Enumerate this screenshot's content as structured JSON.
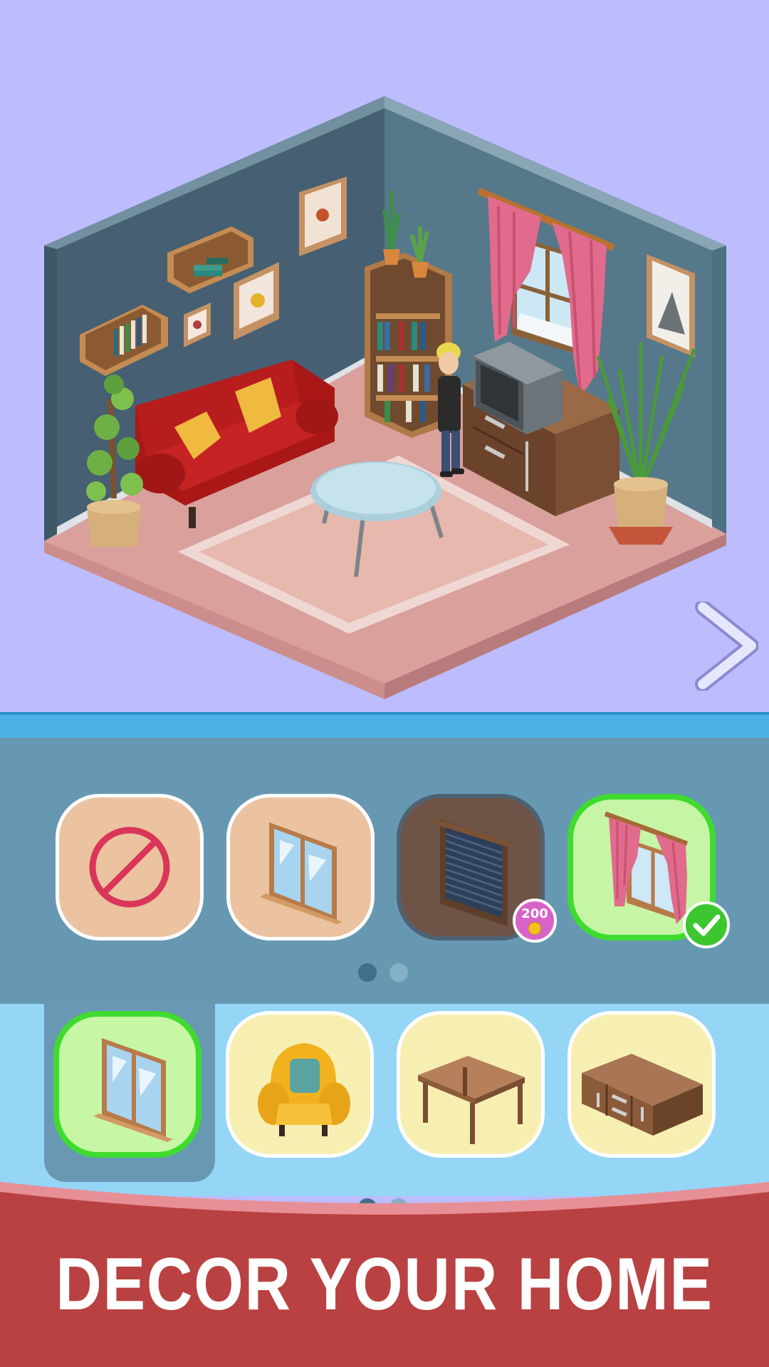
{
  "banner": {
    "text": "DECOR YOUR HOME"
  },
  "options": [
    {
      "name": "none",
      "icon": "no-entry-icon",
      "state": "available"
    },
    {
      "name": "plain-window",
      "icon": "window-icon",
      "state": "available"
    },
    {
      "name": "blinds-window",
      "icon": "blinds-window-icon",
      "state": "locked",
      "price": "200",
      "price_icon": "coin-icon"
    },
    {
      "name": "curtain-window",
      "icon": "curtain-window-icon",
      "state": "selected",
      "selected_icon": "checkmark-icon"
    }
  ],
  "options_pager": {
    "pages": 2,
    "current": 1
  },
  "categories": [
    {
      "name": "windows",
      "icon": "window-icon",
      "selected": true
    },
    {
      "name": "armchair",
      "icon": "armchair-icon",
      "selected": false
    },
    {
      "name": "table",
      "icon": "table-icon",
      "selected": false
    },
    {
      "name": "cabinet",
      "icon": "cabinet-icon",
      "selected": false
    }
  ],
  "categories_pager": {
    "pages": 2,
    "current": 1
  },
  "colors": {
    "background": "#bcbcfe",
    "options_panel": "#6798b2",
    "category_bar": "#95d5f6",
    "banner": "#b94141",
    "selected_border": "#3fdc2f",
    "price_badge": "#d863c7"
  }
}
